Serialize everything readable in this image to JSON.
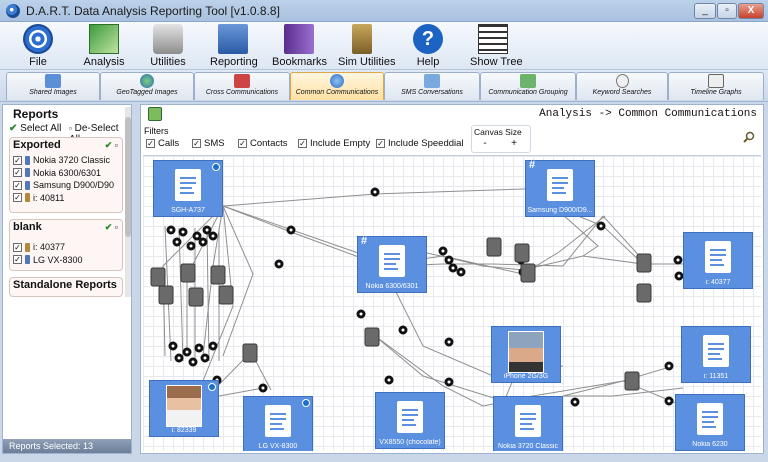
{
  "window": {
    "title": "D.A.R.T. Data Analysis Reporting Tool [v1.0.8.8]",
    "minimize": "_",
    "restore": "▫",
    "close": "X"
  },
  "toolbar": {
    "file": "File",
    "analysis": "Analysis",
    "utilities": "Utilities",
    "reporting": "Reporting",
    "bookmarks": "Bookmarks",
    "sim_utilities": "Sim Utilities",
    "help": "Help",
    "show_tree": "Show Tree"
  },
  "tabs": {
    "shared_images": "Shared Images",
    "geotagged_images": "GeoTagged Images",
    "cross_comm": "Cross Communications",
    "common_comm": "Common Communications",
    "sms_conv": "SMS Conversations",
    "comm_grouping": "Communication Grouping",
    "keyword_searches": "Keyword Searches",
    "timeline_graphs": "Timeline Graphs"
  },
  "sidebar": {
    "title": "Reports",
    "select_all": "Select All",
    "deselect_all": "De-Select All",
    "group_exported": "Exported",
    "exported_items": [
      "Nokia 3720 Classic",
      "Nokia 6300/6301",
      "Samsung D900/D90",
      "i: 40811"
    ],
    "group_blank": "blank",
    "blank_items": [
      "i: 40377",
      "LG VX-8300"
    ],
    "group_standalone": "Standalone Reports",
    "status": "Reports Selected: 13"
  },
  "main": {
    "breadcrumb": "Analysis -> Common Communications",
    "filters_label": "Filters",
    "filters": [
      "Calls",
      "SMS",
      "Contacts",
      "Include Empty",
      "Include Speeddial"
    ],
    "canvas_size_label": "Canvas Size",
    "zoom_out": "-",
    "zoom_in": "+"
  },
  "nodes": [
    {
      "label": "SGH-A737",
      "kind": "doc"
    },
    {
      "label": "Samsung D900/D9...",
      "kind": "doc"
    },
    {
      "label": "Nokia 6300/6301",
      "kind": "doc"
    },
    {
      "label": "i: 40377",
      "kind": "doc"
    },
    {
      "label": "iPhone 2G/3G",
      "kind": "photo"
    },
    {
      "label": "i: 11351",
      "kind": "doc"
    },
    {
      "label": "i: 82339",
      "kind": "photo"
    },
    {
      "label": "LG VX-8300",
      "kind": "doc"
    },
    {
      "label": "VX8550 (chocolate)",
      "kind": "doc"
    },
    {
      "label": "Nokia 3720 Classic",
      "kind": "doc"
    },
    {
      "label": "Nokia 6230",
      "kind": "doc"
    }
  ],
  "node_marks": {
    "hash": "#"
  },
  "colors": {
    "node": "#5b8fe0",
    "edge": "#8a8a8a",
    "accent": "#ffe0a3"
  }
}
